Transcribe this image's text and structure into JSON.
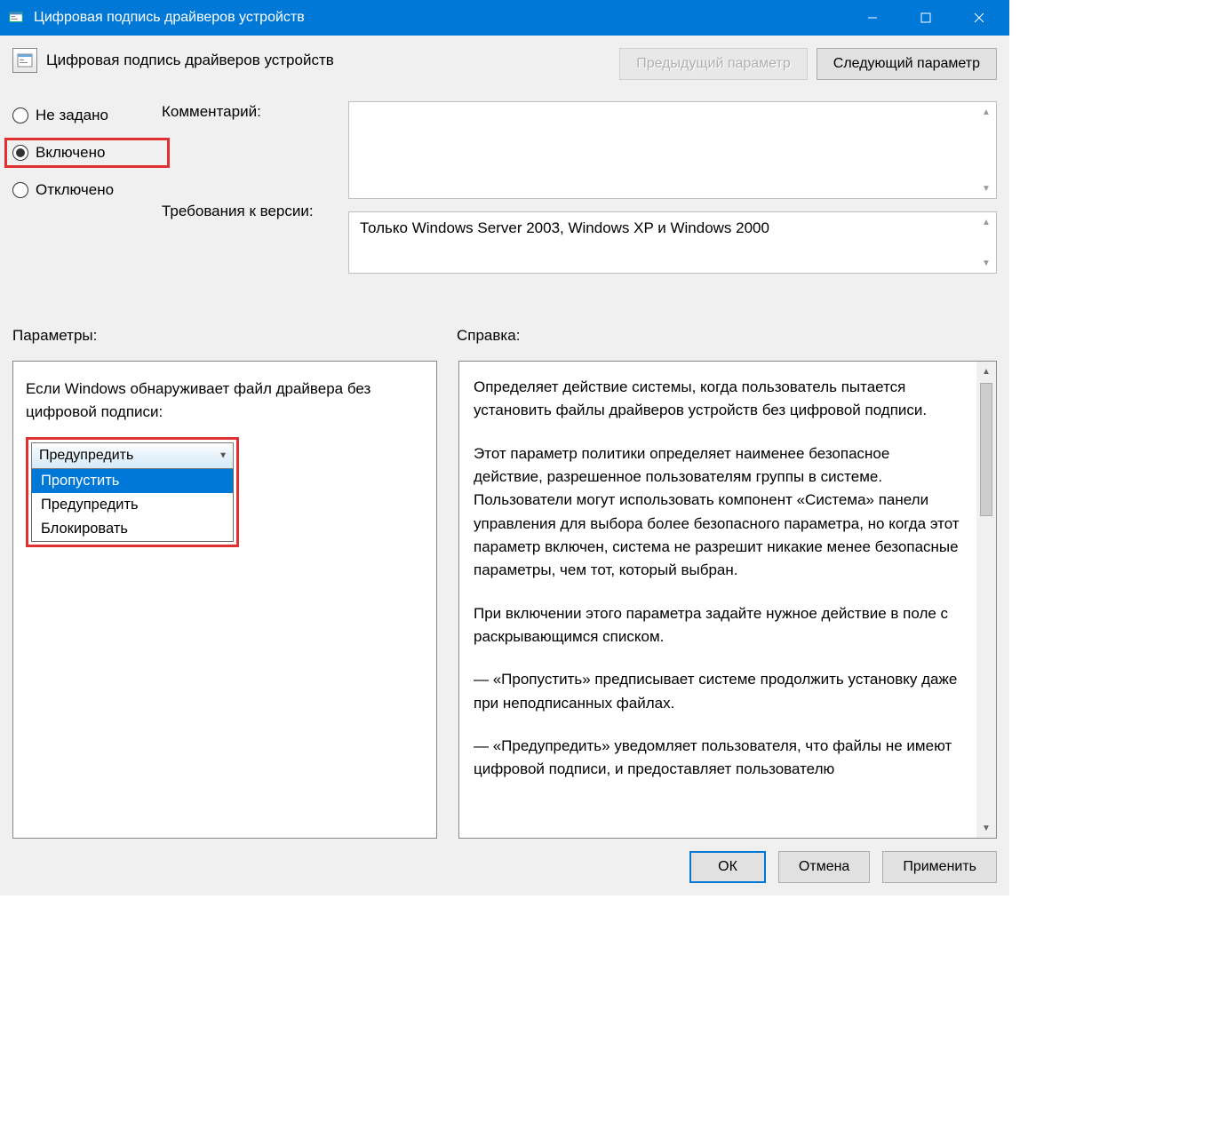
{
  "titlebar": {
    "text": "Цифровая подпись драйверов устройств"
  },
  "header": {
    "title": "Цифровая подпись драйверов устройств",
    "prev": "Предыдущий параметр",
    "next": "Следующий параметр"
  },
  "radios": {
    "not_set": "Не задано",
    "enabled": "Включено",
    "disabled": "Отключено"
  },
  "labels": {
    "comment": "Комментарий:",
    "requirements": "Требования к версии:",
    "params": "Параметры:",
    "help": "Справка:"
  },
  "requirements_text": "Только Windows Server 2003, Windows XP и Windows 2000",
  "params": {
    "prompt": "Если Windows обнаруживает файл драйвера без цифровой подписи:",
    "selected": "Предупредить",
    "options": [
      "Пропустить",
      "Предупредить",
      "Блокировать"
    ]
  },
  "help": {
    "p1": "Определяет действие системы, когда пользователь пытается установить файлы драйверов устройств без цифровой подписи.",
    "p2": "Этот параметр политики определяет наименее безопасное действие, разрешенное пользователям группы в системе. Пользователи могут использовать компонент «Система» панели управления для выбора более безопасного параметра, но когда этот параметр включен, система не разрешит никакие менее безопасные параметры, чем тот, который выбран.",
    "p3": "При включении этого параметра задайте нужное действие в поле с раскрывающимся списком.",
    "p4": "— «Пропустить» предписывает системе продолжить установку даже при неподписанных файлах.",
    "p5": "— «Предупредить» уведомляет пользователя, что файлы не имеют цифровой подписи, и предоставляет пользователю"
  },
  "footer": {
    "ok": "ОК",
    "cancel": "Отмена",
    "apply": "Применить"
  }
}
